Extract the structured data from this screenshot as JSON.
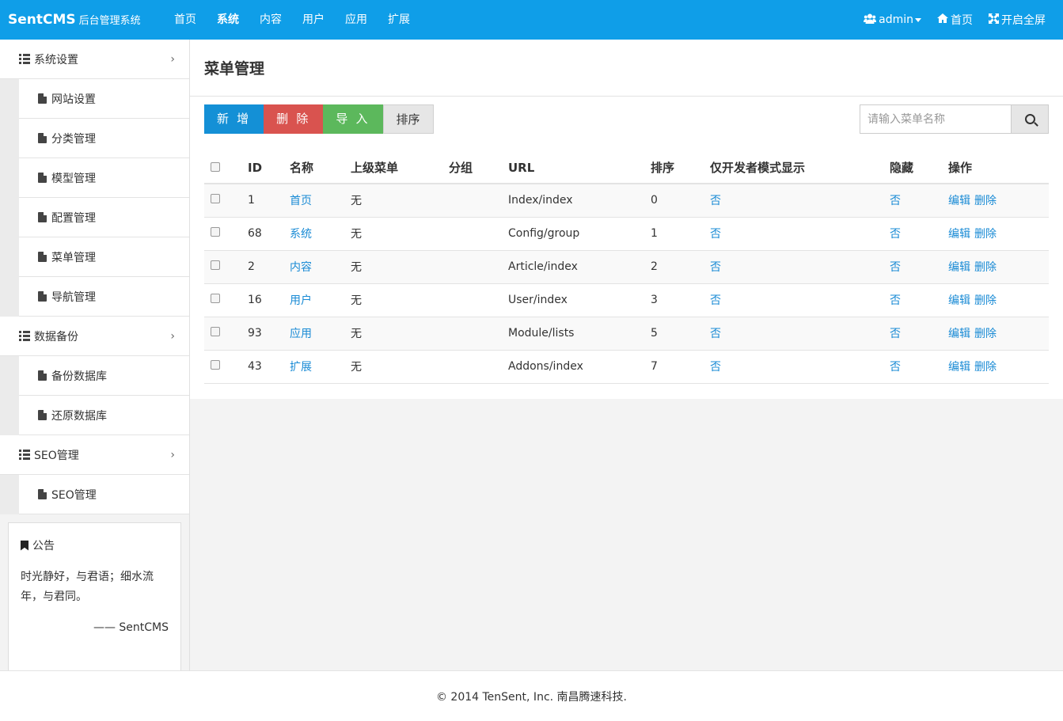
{
  "brand": {
    "name": "SentCMS",
    "subtitle": "后台管理系统"
  },
  "nav": [
    "首页",
    "系统",
    "内容",
    "用户",
    "应用",
    "扩展"
  ],
  "nav_right": {
    "user": "admin",
    "home": "首页",
    "fullscreen": "开启全屏"
  },
  "sidebar": {
    "groups": [
      {
        "label": "系统设置",
        "items": [
          "网站设置",
          "分类管理",
          "模型管理",
          "配置管理",
          "菜单管理",
          "导航管理"
        ]
      },
      {
        "label": "数据备份",
        "items": [
          "备份数据库",
          "还原数据库"
        ]
      },
      {
        "label": "SEO管理",
        "items": [
          "SEO管理"
        ]
      }
    ],
    "notice": {
      "title": "公告",
      "body": "时光静好，与君语；细水流年，与君同。",
      "sign": "—— SentCMS"
    }
  },
  "main": {
    "title": "菜单管理",
    "toolbar": {
      "add": "新 增",
      "delete": "删 除",
      "import": "导 入",
      "sort": "排序"
    },
    "search": {
      "placeholder": "请输入菜单名称"
    },
    "table": {
      "headers": [
        "ID",
        "名称",
        "上级菜单",
        "分组",
        "URL",
        "排序",
        "仅开发者模式显示",
        "隐藏",
        "操作"
      ],
      "rows": [
        {
          "id": "1",
          "name": "首页",
          "parent": "无",
          "group": "",
          "url": "Index/index",
          "sort": "0",
          "dev": "否",
          "hide": "否"
        },
        {
          "id": "68",
          "name": "系统",
          "parent": "无",
          "group": "",
          "url": "Config/group",
          "sort": "1",
          "dev": "否",
          "hide": "否"
        },
        {
          "id": "2",
          "name": "内容",
          "parent": "无",
          "group": "",
          "url": "Article/index",
          "sort": "2",
          "dev": "否",
          "hide": "否"
        },
        {
          "id": "16",
          "name": "用户",
          "parent": "无",
          "group": "",
          "url": "User/index",
          "sort": "3",
          "dev": "否",
          "hide": "否"
        },
        {
          "id": "93",
          "name": "应用",
          "parent": "无",
          "group": "",
          "url": "Module/lists",
          "sort": "5",
          "dev": "否",
          "hide": "否"
        },
        {
          "id": "43",
          "name": "扩展",
          "parent": "无",
          "group": "",
          "url": "Addons/index",
          "sort": "7",
          "dev": "否",
          "hide": "否"
        }
      ],
      "ops": {
        "edit": "编辑",
        "delete": "删除"
      }
    }
  },
  "footer": "© 2014 TenSent, Inc. 南昌腾速科技.",
  "colors": {
    "primary": "#0f9ee8",
    "add": "#1490d6",
    "danger": "#d9534f",
    "success": "#5cb85c",
    "link": "#1a8bd5"
  }
}
